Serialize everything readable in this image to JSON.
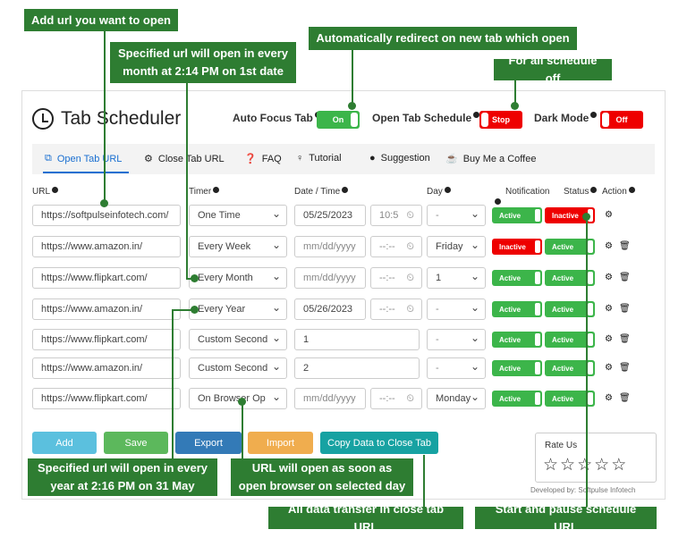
{
  "app": {
    "title": "Tab Scheduler"
  },
  "controls": {
    "auto_focus": {
      "label": "Auto Focus Tab",
      "state": "On"
    },
    "open_tab_schedule": {
      "label": "Open Tab Schedule",
      "state": "Stop"
    },
    "dark_mode": {
      "label": "Dark Mode",
      "state": "Off"
    }
  },
  "tabs": [
    {
      "label": "Open Tab URL",
      "icon": "external-link-icon"
    },
    {
      "label": "Close Tab URL",
      "icon": "gear-icon"
    },
    {
      "label": "FAQ",
      "icon": "question-icon"
    },
    {
      "label": "Tutorial",
      "icon": "lightbulb-icon"
    },
    {
      "label": "Suggestion",
      "icon": "chat-icon"
    },
    {
      "label": "Buy Me a Coffee",
      "icon": "coffee-icon"
    }
  ],
  "headers": {
    "url": "URL",
    "timer": "Timer",
    "datetime": "Date / Time",
    "day": "Day",
    "notification": "Notification",
    "status": "Status",
    "action": "Action"
  },
  "rows": [
    {
      "url": "https://softpulseinfotech.com/",
      "timer": "One Time",
      "date": "05/25/2023",
      "time": "10:5",
      "day": "-",
      "notification": "Active",
      "status": "Inactive"
    },
    {
      "url": "https://www.amazon.in/",
      "timer": "Every Week",
      "date": "mm/dd/yyyy",
      "time": "--:--",
      "day": "Friday",
      "notification": "Inactive",
      "status": "Active"
    },
    {
      "url": "https://www.flipkart.com/",
      "timer": "Every Month",
      "date": "mm/dd/yyyy",
      "time": "--:--",
      "day": "1",
      "notification": "Active",
      "status": "Active"
    },
    {
      "url": "https://www.amazon.in/",
      "timer": "Every Year",
      "date": "05/26/2023",
      "time": "--:--",
      "day": "-",
      "notification": "Active",
      "status": "Active"
    },
    {
      "url": "https://www.flipkart.com/",
      "timer": "Custom Second",
      "date": "1",
      "time": "",
      "day": "-",
      "notification": "Active",
      "status": "Active"
    },
    {
      "url": "https://www.amazon.in/",
      "timer": "Custom Second",
      "date": "2",
      "time": "",
      "day": "-",
      "notification": "Active",
      "status": "Active"
    },
    {
      "url": "https://www.flipkart.com/",
      "timer": "On Browser Op",
      "date": "mm/dd/yyyy",
      "time": "--:--",
      "day": "Monday",
      "notification": "Active",
      "status": "Active"
    }
  ],
  "buttons": {
    "add": "Add",
    "save": "Save",
    "export": "Export",
    "import": "Import",
    "copy": "Copy Data to Close Tab"
  },
  "rate": {
    "label": "Rate Us"
  },
  "developer": "Developed by: Softpulse Infotech",
  "callouts": {
    "add_url": "Add url you want to open",
    "monthly": "Specified url will open in every month at 2:14 PM on 1st date",
    "redirect": "Automatically redirect on new tab which open",
    "schedule_off": "For all schedule off",
    "yearly": "Specified url will open in every year at 2:16 PM on 31 May",
    "browser_open": "URL will open as soon as open browser on selected day",
    "transfer": "All data transfer in close tab URL",
    "start_pause": "Start and pause schedule URL"
  },
  "colors": {
    "callout": "#2e7d32",
    "active": "#3cb54a",
    "inactive": "#ee0000",
    "tab_active": "#1a6fd1",
    "add": "#5bc0de",
    "save": "#5cb85c",
    "export": "#337ab7",
    "import": "#f0ad4e",
    "copy": "#17a2a2"
  }
}
